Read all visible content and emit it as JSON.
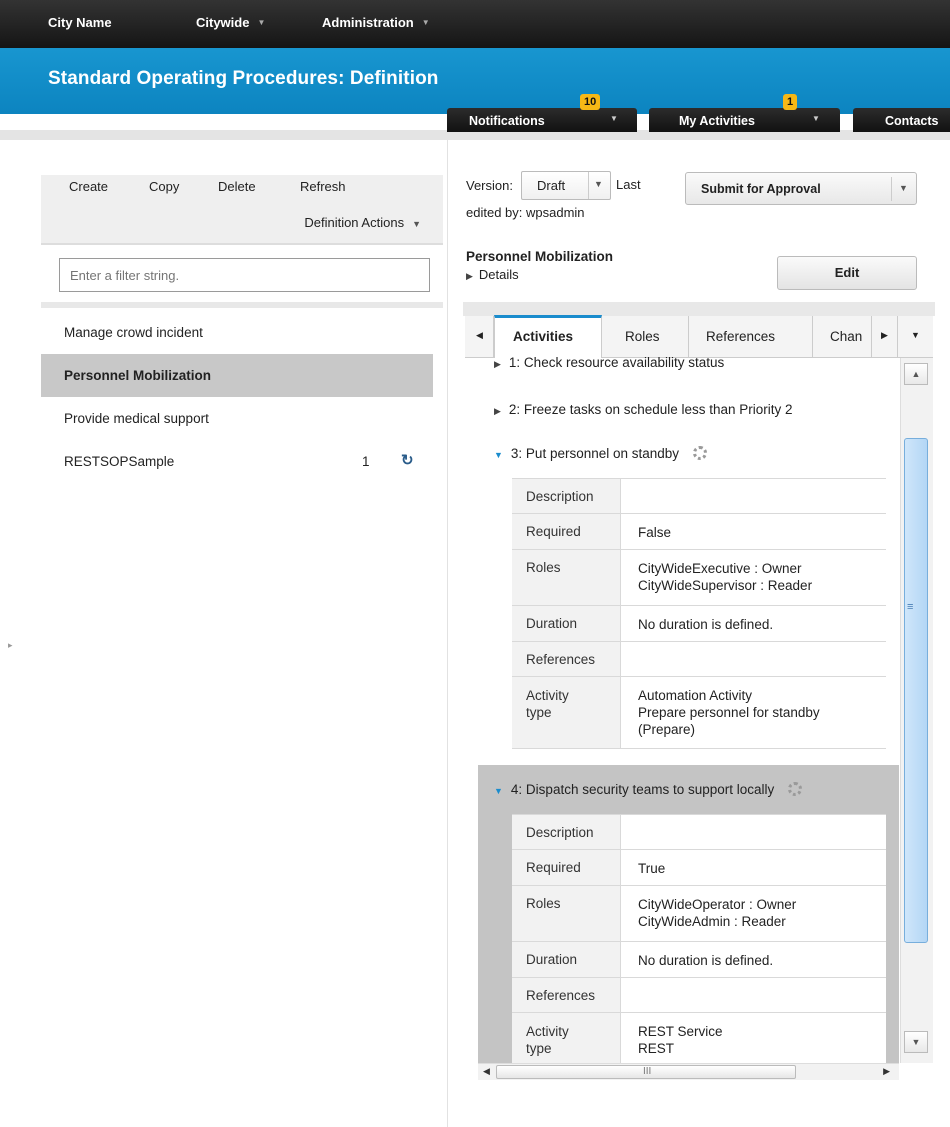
{
  "topnav": {
    "city": "City Name",
    "citywide": "Citywide",
    "admin": "Administration"
  },
  "header": {
    "title": "Standard Operating Procedures: Definition"
  },
  "tray": {
    "notifications": {
      "label": "Notifications",
      "count": "10"
    },
    "activities": {
      "label": "My Activities",
      "count": "1"
    },
    "contacts": {
      "label": "Contacts"
    }
  },
  "icons": {
    "caret_down": "▼",
    "caret_right": "▶",
    "caret_left": "◀",
    "caret_up": "▲",
    "refresh": "↻",
    "grip_h": "≡",
    "grip_v": "III",
    "splitter": "▸"
  },
  "left": {
    "toolbar": {
      "create": "Create",
      "copy": "Copy",
      "delete": "Delete",
      "refresh": "Refresh",
      "definition_actions": "Definition Actions"
    },
    "filter_placeholder": "Enter a filter string.",
    "items": [
      {
        "label": "Manage crowd incident"
      },
      {
        "label": "Personnel Mobilization",
        "selected": true
      },
      {
        "label": "Provide medical support"
      },
      {
        "label": "RESTSOPSample",
        "count": "1"
      }
    ]
  },
  "right": {
    "version_label": "Version:",
    "version_value": "Draft",
    "last_label": "Last",
    "edited_by": "edited by: wpsadmin",
    "submit": "Submit for Approval",
    "sop_name": "Personnel Mobilization",
    "details": "Details",
    "edit": "Edit",
    "tabs": [
      "Activities",
      "Roles",
      "References",
      "Chan"
    ],
    "activities": [
      {
        "title": "1: Check resource availability status"
      },
      {
        "title": "2: Freeze tasks on schedule less than Priority 2"
      },
      {
        "title": "3: Put personnel on standby",
        "rows": [
          {
            "k": "Description",
            "v": ""
          },
          {
            "k": "Required",
            "v": "False"
          },
          {
            "k": "Roles",
            "v": "CityWideExecutive : Owner\nCityWideSupervisor : Reader"
          },
          {
            "k": "Duration",
            "v": "No duration is defined."
          },
          {
            "k": "References",
            "v": ""
          },
          {
            "k": "Activity\ntype",
            "v": "Automation Activity\nPrepare personnel for standby\n(Prepare)"
          }
        ]
      },
      {
        "title": "4: Dispatch security teams to support locally",
        "rows": [
          {
            "k": "Description",
            "v": ""
          },
          {
            "k": "Required",
            "v": "True"
          },
          {
            "k": "Roles",
            "v": "CityWideOperator : Owner\nCityWideAdmin : Reader"
          },
          {
            "k": "Duration",
            "v": "No duration is defined."
          },
          {
            "k": "References",
            "v": ""
          },
          {
            "k": "Activity\ntype",
            "v": "REST Service\nREST"
          }
        ]
      }
    ]
  }
}
